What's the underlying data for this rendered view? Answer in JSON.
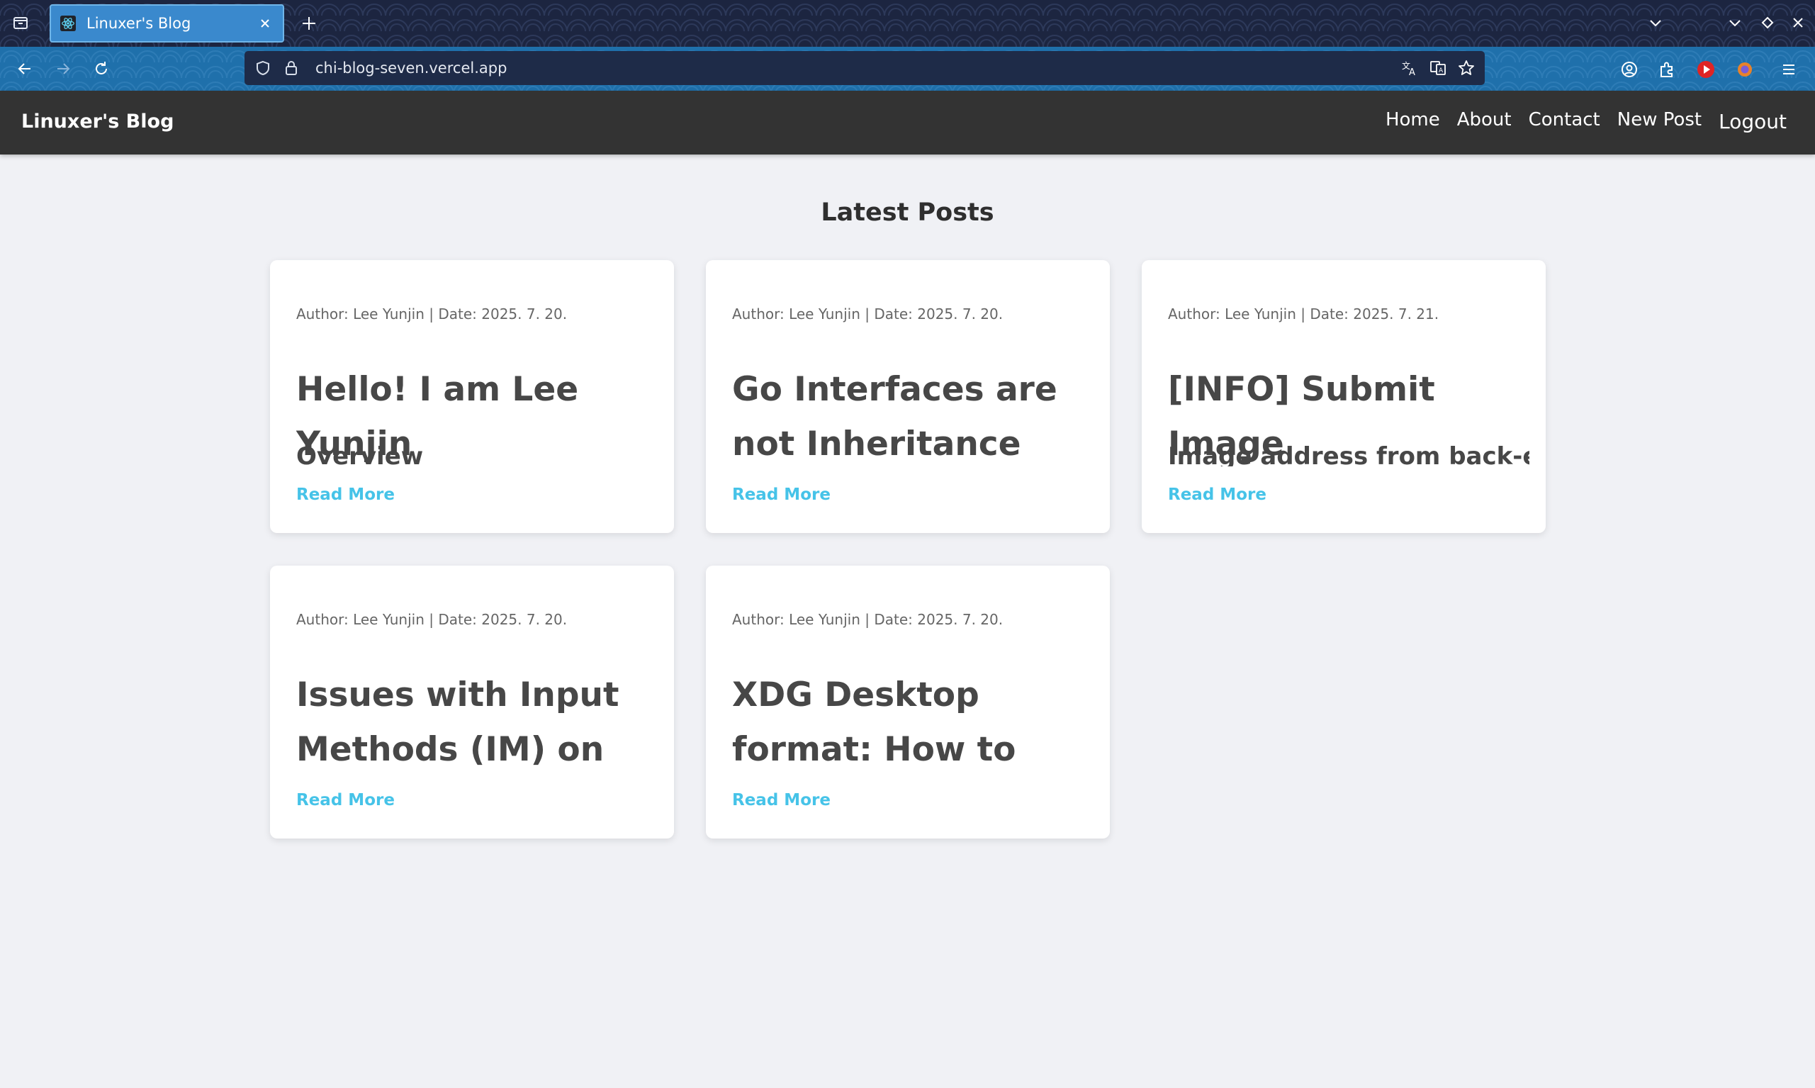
{
  "browser": {
    "tab_title": "Linuxer's Blog",
    "url": "chi-blog-seven.vercel.app"
  },
  "site": {
    "brand": "Linuxer's Blog",
    "nav": {
      "home": "Home",
      "about": "About",
      "contact": "Contact",
      "new_post": "New Post",
      "logout": "Logout"
    },
    "section_title": "Latest Posts",
    "read_more": "Read More",
    "posts": [
      {
        "meta": "Author: Lee Yunjin | Date: 2025. 7. 20.",
        "title": "Hello! I am Lee Yunjin",
        "excerpt": "Overview"
      },
      {
        "meta": "Author: Lee Yunjin | Date: 2025. 7. 20.",
        "title": "Go Interfaces are not Inheritance",
        "excerpt": ""
      },
      {
        "meta": "Author: Lee Yunjin | Date: 2025. 7. 21.",
        "title": "[INFO] Submit Image",
        "excerpt": "Image address from back-end"
      },
      {
        "meta": "Author: Lee Yunjin | Date: 2025. 7. 20.",
        "title": "Issues with Input Methods (IM) on Linux",
        "excerpt": ""
      },
      {
        "meta": "Author: Lee Yunjin | Date: 2025. 7. 20.",
        "title": "XDG Desktop format: How to Highlight it -",
        "excerpt": ""
      }
    ]
  },
  "colors": {
    "tab_bar": "#1c2540",
    "nav_bar": "#1f70ab",
    "active_tab": "#3a89cd",
    "site_header": "#333333",
    "page_bg": "#f0f1f5",
    "link_accent": "#46c3e8"
  },
  "icons": {
    "tab_list": "tab-list-icon",
    "favicon": "react-atom-icon",
    "close": "close-icon",
    "new_tab": "plus-icon",
    "back": "arrow-left-icon",
    "forward": "arrow-right-icon",
    "reload": "reload-icon",
    "shield": "shield-icon",
    "lock": "lock-icon",
    "translate": "translate-icon",
    "bookmark": "star-icon"
  }
}
